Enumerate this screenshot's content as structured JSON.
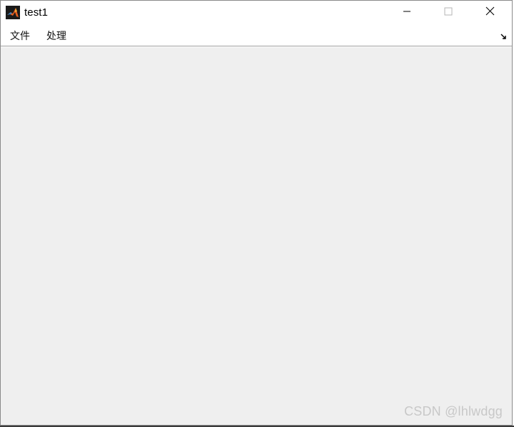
{
  "window": {
    "title": "test1",
    "app_icon": "matlab-logo-icon",
    "controls": {
      "minimize_icon": "minimize-icon",
      "maximize_icon": "maximize-icon",
      "close_icon": "close-icon"
    }
  },
  "menubar": {
    "items": [
      {
        "label": "文件"
      },
      {
        "label": "处理"
      }
    ],
    "dock_icon": "dock-figure-arrow-icon"
  },
  "canvas": {
    "background": "#efefef"
  },
  "watermark": {
    "text": "CSDN @lhlwdgg"
  }
}
